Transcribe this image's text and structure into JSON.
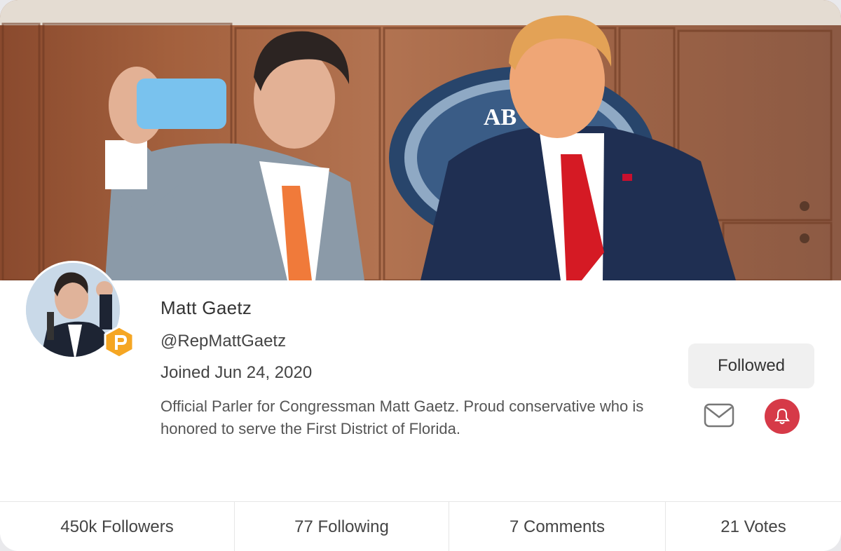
{
  "profile": {
    "name": "Matt Gaetz",
    "handle": "@RepMattGaetz",
    "joined": "Joined Jun 24, 2020",
    "bio": "Official Parler for Congressman Matt Gaetz. Proud conservative who is honored to serve the First District of Florida."
  },
  "actions": {
    "follow_label": "Followed",
    "mail_icon": "envelope-icon",
    "bell_icon": "bell-icon"
  },
  "cover": {
    "seal_text": "AB"
  },
  "stats": [
    {
      "label": "450k Followers"
    },
    {
      "label": "77 Following"
    },
    {
      "label": "7 Comments"
    },
    {
      "label": "21 Votes"
    }
  ],
  "colors": {
    "bell_bg": "#d63a48",
    "badge": "#f5a623",
    "button_bg": "#f0f0f0"
  }
}
